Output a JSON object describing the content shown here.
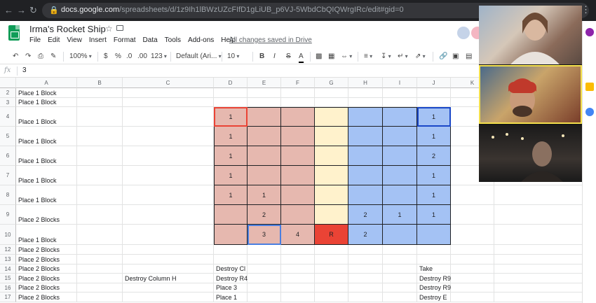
{
  "browser": {
    "url_host": "docs.google.com",
    "url_path": "/spreadsheets/d/1z9Ih1lBWzUZcFIfD1gLiUB_p6VJ-5WbdCbQIQWrgIRc/edit#gid=0",
    "back_icon": "arrow-left-icon",
    "forward_icon": "arrow-right-icon",
    "reload_icon": "reload-icon",
    "lock_icon": "lock-icon",
    "menu_icon": "kebab-icon"
  },
  "doc": {
    "title": "Irma's Rocket Ship",
    "saved_status": "All changes saved in Drive",
    "menus": [
      "File",
      "Edit",
      "View",
      "Insert",
      "Format",
      "Data",
      "Tools",
      "Add-ons",
      "Help"
    ]
  },
  "toolbar": {
    "zoom": "100%",
    "currency": "$",
    "percent": "%",
    "decimal_less": ".0",
    "decimal_more": ".00",
    "format_more": "123",
    "font": "Default (Ari...",
    "font_size": "10",
    "bold": "B",
    "italic": "I",
    "strike": "S",
    "text_color": "A"
  },
  "formula_bar": {
    "fx": "fx",
    "value": "3"
  },
  "columns": [
    "A",
    "B",
    "C",
    "D",
    "E",
    "F",
    "G",
    "H",
    "I",
    "J",
    "K"
  ],
  "rows": [
    {
      "num": "2",
      "a": "Place 1 Block"
    },
    {
      "num": "3",
      "a": "Place 1 Block"
    },
    {
      "num": "4",
      "a": "Place 1 Block",
      "d": "1",
      "j": "1"
    },
    {
      "num": "5",
      "a": "Place 1 Block",
      "d": "1",
      "j": "1"
    },
    {
      "num": "6",
      "a": "Place 1 Block",
      "d": "1",
      "j": "2"
    },
    {
      "num": "7",
      "a": "Place 1 Block",
      "d": "1",
      "j": "1"
    },
    {
      "num": "8",
      "a": "Place 1 Block",
      "d": "1",
      "e": "1",
      "j": "1"
    },
    {
      "num": "9",
      "a": "Place 2 Blocks",
      "e": "2",
      "h": "2",
      "i": "1",
      "j": "1"
    },
    {
      "num": "10",
      "a": "Place 1 Block",
      "e": "3",
      "f": "4",
      "g": "R",
      "h": "2"
    },
    {
      "num": "12",
      "a": "Place 2 Blocks"
    },
    {
      "num": "13",
      "a": "Place 2 Blocks"
    },
    {
      "num": "14",
      "a": "Place 2 Blocks",
      "d": "Destroy Cl",
      "j": "Take"
    },
    {
      "num": "15",
      "a": "Place 2 Blocks",
      "c": "Destroy Column H",
      "d": "Destroy R4",
      "j": "Destroy R9"
    },
    {
      "num": "16",
      "a": "Place 2 Blocks",
      "d": "Place 3",
      "j": "Destroy R9"
    },
    {
      "num": "17",
      "a": "Place 2 Blocks",
      "d": "Place 1",
      "j": "Destroy E"
    }
  ],
  "colors": {
    "pink": "#e6b8af",
    "yellow": "#fff2cc",
    "blue": "#a4c2f4",
    "red": "#ea4335",
    "sheets_green": "#0f9d58"
  }
}
